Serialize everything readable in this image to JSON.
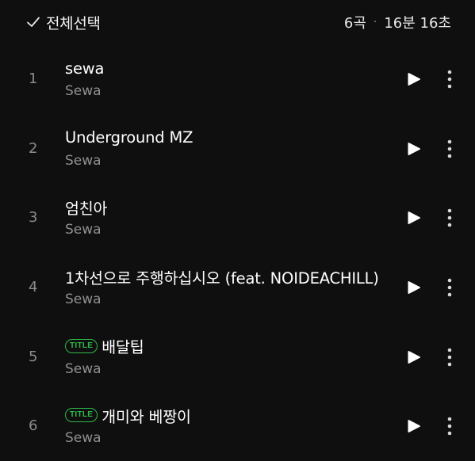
{
  "header": {
    "select_all_label": "전체선택",
    "track_count": "6곡",
    "separator": "·",
    "total_duration": "16분 16초"
  },
  "colors": {
    "background": "#0f0f0f",
    "title_badge": "#2fb94a",
    "secondary_text": "#8f8f8f"
  },
  "icons": {
    "check": "check-icon",
    "play": "play-icon",
    "more": "more-vertical-icon"
  },
  "tracks": [
    {
      "number": "1",
      "title": "sewa",
      "artist": "Sewa",
      "badge": ""
    },
    {
      "number": "2",
      "title": "Underground MZ",
      "artist": "Sewa",
      "badge": ""
    },
    {
      "number": "3",
      "title": "엄친아",
      "artist": "Sewa",
      "badge": ""
    },
    {
      "number": "4",
      "title": "1차선으로 주행하십시오 (feat. NOIDEACHILL)",
      "artist": "Sewa",
      "badge": ""
    },
    {
      "number": "5",
      "title": "배달팁",
      "artist": "Sewa",
      "badge": "TITLE"
    },
    {
      "number": "6",
      "title": "개미와 베짱이",
      "artist": "Sewa",
      "badge": "TITLE"
    }
  ]
}
